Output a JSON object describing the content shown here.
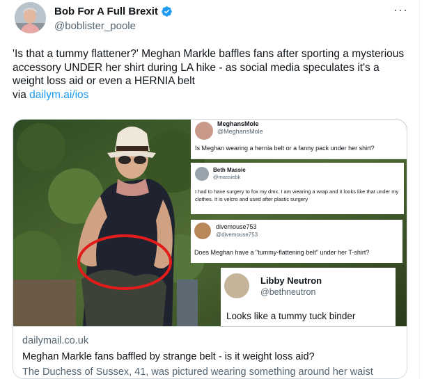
{
  "tweet": {
    "author_name": "Bob For A Full Brexit",
    "author_handle": "@boblister_poole",
    "more_label": "···",
    "text": "'Is that a tummy flattener?' Meghan Markle baffles fans after sporting a mysterious accessory UNDER her shirt during LA hike - as social media speculates it's a weight loss aid or even a HERNIA belt",
    "via_prefix": "via ",
    "via_link": "dailym.ai/ios"
  },
  "card": {
    "domain": "dailymail.co.uk",
    "title": "Meghan Markle fans baffled by strange belt - is it weight loss aid?",
    "description": "The Duchess of Sussex, 41, was pictured wearing something around her waist"
  },
  "embedded_tweets": [
    {
      "name": "MeghansMole",
      "handle": "@MeghansMole",
      "text": "Is Meghan wearing a hernia belt or a fanny pack under her shirt?"
    },
    {
      "name": "Beth Massie",
      "handle": "@massiebk",
      "text": "I had to have surgery to fox my dmx. I am wearing a wrap and it looks like that under my clothes. It is velcro and used after plastic surgery"
    },
    {
      "name": "divemouse753",
      "handle": "@divemouse753",
      "text": "Does Meghan have a \"tummy-flattening belt\" under her T-shirt?"
    },
    {
      "name": "Libby Neutron",
      "handle": "@bethneutron",
      "text": "Looks like a tummy tuck binder"
    }
  ],
  "colors": {
    "link": "#1d9bf0",
    "verified": "#1d9bf0",
    "muted": "#536471",
    "circle": "#e21b1b"
  },
  "icons": {
    "verified": "verified-badge-icon",
    "more": "more-options-icon"
  }
}
